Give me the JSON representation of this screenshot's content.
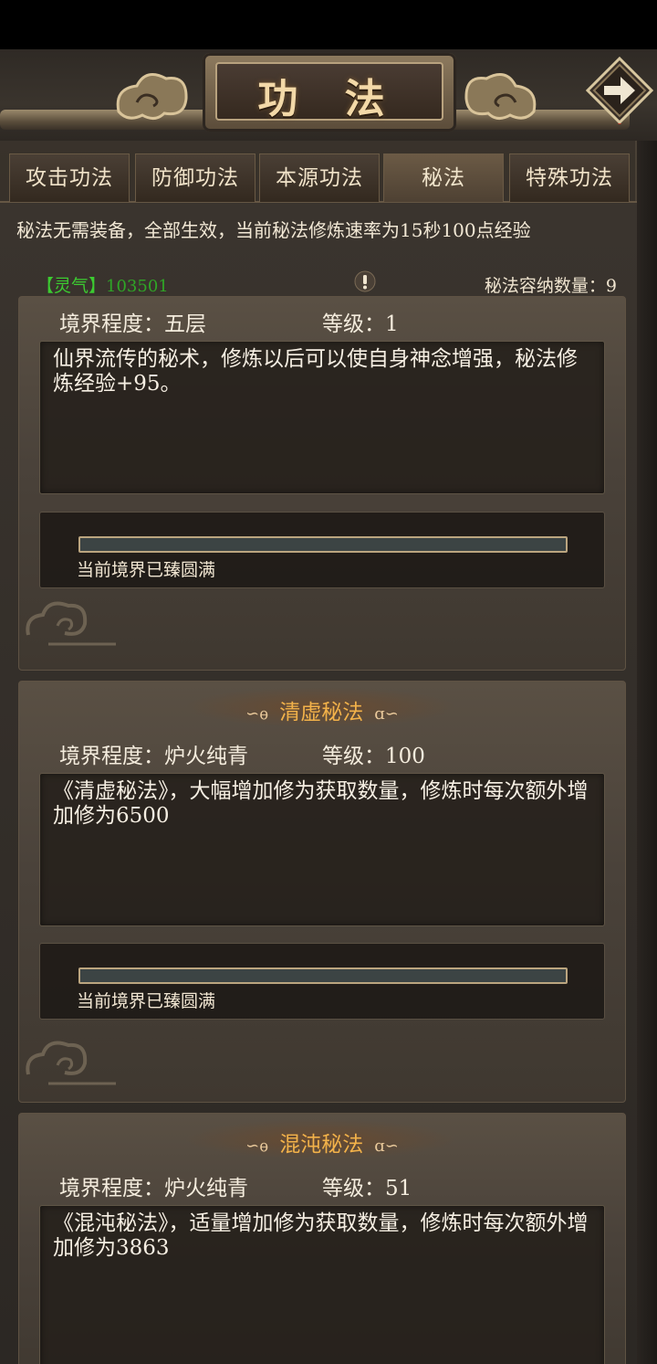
{
  "header": {
    "title": "功 法"
  },
  "tabs": [
    {
      "label": "攻击功法",
      "active": false
    },
    {
      "label": "防御功法",
      "active": false
    },
    {
      "label": "本源功法",
      "active": false
    },
    {
      "label": "秘法",
      "active": true
    },
    {
      "label": "特殊功法",
      "active": false
    }
  ],
  "notice": "秘法无需装备，全部生效，当前秘法修炼速率为15秒100点经验",
  "resource": {
    "label": "【灵气】",
    "value": "103501"
  },
  "capacity": {
    "label": "秘法容纳数量：",
    "value": "9"
  },
  "cards": [
    {
      "title": "",
      "realm_label": "境界程度：五层",
      "level_label": "等级：1",
      "description": "仙界流传的秘术，修炼以后可以使自身神念增强，秘法修炼经验+95。",
      "progress_text": "当前境界已臻圆满",
      "progress": 1.0
    },
    {
      "title": "清虚秘法",
      "realm_label": "境界程度：炉火纯青",
      "level_label": "等级：100",
      "description": "《清虚秘法》，大幅增加修为获取数量，修炼时每次额外增加修为6500",
      "progress_text": "当前境界已臻圆满",
      "progress": 1.0
    },
    {
      "title": "混沌秘法",
      "realm_label": "境界程度：炉火纯青",
      "level_label": "等级：51",
      "description": "《混沌秘法》，适量增加修为获取数量，修炼时每次额外增加修为3863"
    }
  ],
  "colors": {
    "accent_title": "#f2b24a",
    "resource_green": "#3ccb31",
    "title_gold": "#f3d9a8"
  },
  "icons": {
    "back": "arrow-right-icon",
    "warning": "exclamation-icon"
  }
}
